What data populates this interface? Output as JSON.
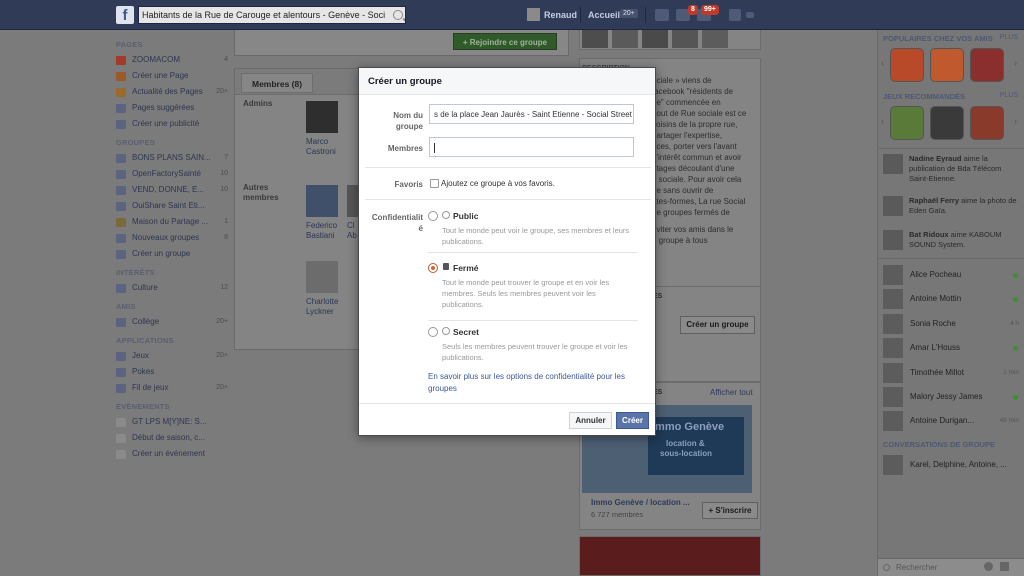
{
  "topbar": {
    "search_value": "Habitants de la Rue de Carouge et alentours - Genève - Soci",
    "user_name": "Renaud",
    "home_label": "Accueil",
    "home_count": "20+",
    "messages_badge": "8",
    "notifications_badge": "99+"
  },
  "sidebar": {
    "pages_title": "PAGES",
    "pages": [
      {
        "label": "ZOOMACOM",
        "count": "4"
      },
      {
        "label": "Créer une Page",
        "count": ""
      },
      {
        "label": "Actualité des Pages",
        "count": "20+"
      },
      {
        "label": "Pages suggérées",
        "count": ""
      },
      {
        "label": "Créer une publicité",
        "count": ""
      }
    ],
    "groups_title": "GROUPES",
    "groups": [
      {
        "label": "BONS PLANS SAIN...",
        "count": "7"
      },
      {
        "label": "OpenFactorySainté",
        "count": "10"
      },
      {
        "label": "VEND, DONNE, E...",
        "count": "10"
      },
      {
        "label": "OuiShare Saint Eti...",
        "count": ""
      },
      {
        "label": "Maison du Partage ...",
        "count": "1"
      },
      {
        "label": "Nouveaux groupes",
        "count": "8"
      },
      {
        "label": "Créer un groupe",
        "count": ""
      }
    ],
    "interests_title": "INTÉRÊTS",
    "interests": [
      {
        "label": "Culture",
        "count": "12"
      }
    ],
    "friends_title": "AMIS",
    "friends": [
      {
        "label": "Collège",
        "count": "20+"
      }
    ],
    "apps_title": "APPLICATIONS",
    "apps": [
      {
        "label": "Jeux",
        "count": "20+"
      },
      {
        "label": "Pokes",
        "count": ""
      },
      {
        "label": "Fil de jeux",
        "count": "20+"
      }
    ],
    "events_title": "ÉVÉNEMENTS",
    "events": [
      {
        "label": "GT LPS M[Y]NE: S...",
        "count": ""
      },
      {
        "label": "Début de saison, c...",
        "count": ""
      },
      {
        "label": "Créer un événement",
        "count": ""
      }
    ]
  },
  "group": {
    "join_label": "+ Rejoindre ce groupe",
    "members_tab": "Membres (8)",
    "admins_label": "Admins",
    "other_members_label": "Autres membres",
    "admin_name": "Marco Castroni",
    "member1": "Federico Bastiani",
    "member2_partial": "Cl Ab",
    "member3": "Charlotte Lyckner"
  },
  "mid_right": {
    "description_title": "DESCRIPTION",
    "description_lines": [
      "ociale » viens de",
      "facebook \"résidents de",
      "ne\" commencée en",
      "bout de Rue sociale est ce",
      "voisins de la propre rue,",
      "partager l'expertise,",
      "nces, porter vers l'avant",
      "d'intérêt commun et avoir",
      "ntages découlant d'une",
      "n sociale. Pour avoir cela",
      "ire sans ouvrir de",
      "ates-formes, La rue Social",
      "de groupes fermés de",
      "",
      "nviter vos amis dans le",
      "e groupe à tous"
    ],
    "groups_box_partial": "ES",
    "create_group_btn": "Créer un groupe",
    "suggested_partial": "ES",
    "show_all": "Afficher tout",
    "ad_line1": "Immo Genève",
    "ad_line2": "location &",
    "ad_line3": "sous-location",
    "ad_title": "Immo Genève / location ...",
    "ad_members": "6 727 membres",
    "ad_join": "+ S'inscrire"
  },
  "right": {
    "popular_title": "POPULAIRES CHEZ VOS AMIS",
    "popular_plus": "PLUS",
    "recommended_title": "JEUX RECOMMANDÉS",
    "recommended_plus": "PLUS",
    "feed": [
      {
        "name": "Nadine Eyraud",
        "text": " aime la publication de Bda Télécom Saint-Etienne."
      },
      {
        "name": "Raphaël Ferry",
        "text": " aime la photo de Eden Gaïa."
      },
      {
        "name": "Bat Ridoux",
        "text": " aime KABOUM SOUND System."
      }
    ],
    "chat": [
      {
        "name": "Alice Pocheau",
        "status": ""
      },
      {
        "name": "Antoine Mottin",
        "status": ""
      },
      {
        "name": "Sonia Roche",
        "status": "4 h"
      },
      {
        "name": "Amar L'Houss",
        "status": ""
      },
      {
        "name": "Timothée Millot",
        "status": "1 min"
      },
      {
        "name": "Malory Jessy James",
        "status": ""
      },
      {
        "name": "Antoine Durigan...",
        "status": "48 min"
      }
    ],
    "conversations_title": "CONVERSATIONS DE GROUPE",
    "conversation": "Karel, Delphine, Antoine, ...",
    "chat_search_placeholder": "Rechercher"
  },
  "modal": {
    "title": "Créer un groupe",
    "name_label_1": "Nom du",
    "name_label_2": "groupe",
    "name_value": "s de la place Jean Jaurès - Saint Etienne - Social Street",
    "members_label": "Membres",
    "members_value": "",
    "favorites_label": "Favoris",
    "favorites_text": "Ajoutez ce groupe à vos favoris.",
    "privacy_label_1": "Confidentialit",
    "privacy_label_2": "é",
    "options": [
      {
        "title": "Public",
        "desc": "Tout le monde peut voir le groupe, ses membres et leurs publications."
      },
      {
        "title": "Fermé",
        "desc": "Tout le monde peut trouver le groupe et en voir les membres. Seuls les membres peuvent voir les publications."
      },
      {
        "title": "Secret",
        "desc": "Seuls les membres peuvent trouver le groupe et voir les publications."
      }
    ],
    "selected_option": "Fermé",
    "learn_more": "En savoir plus sur les options de confidentialité pour les groupes",
    "cancel_label": "Annuler",
    "create_label": "Créer"
  },
  "colors": {
    "facebook_blue": "#3b5998",
    "create_button": "#5b74a8",
    "join_green": "#42b72a",
    "selected_radio": "#d9622b"
  }
}
